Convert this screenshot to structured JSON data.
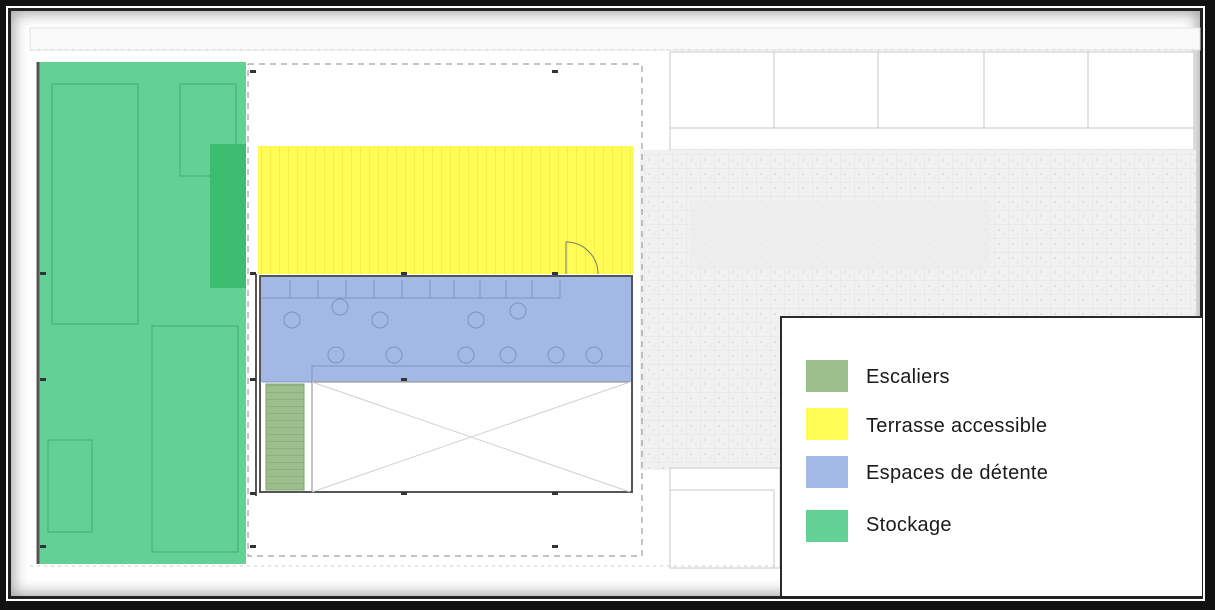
{
  "legend": {
    "items": [
      {
        "label": "Escaliers",
        "color": "#9dbf8b"
      },
      {
        "label": "Terrasse accessible",
        "color": "#fffd55"
      },
      {
        "label": "Espaces de détente",
        "color": "#a4b8e6"
      },
      {
        "label": "Stockage",
        "color": "#63d195"
      }
    ]
  },
  "zones": {
    "stockage_color": "#63d195",
    "terrasse_color": "#fffd55",
    "detente_color": "#a4b8e6",
    "escaliers_color": "#9dbf8b"
  }
}
